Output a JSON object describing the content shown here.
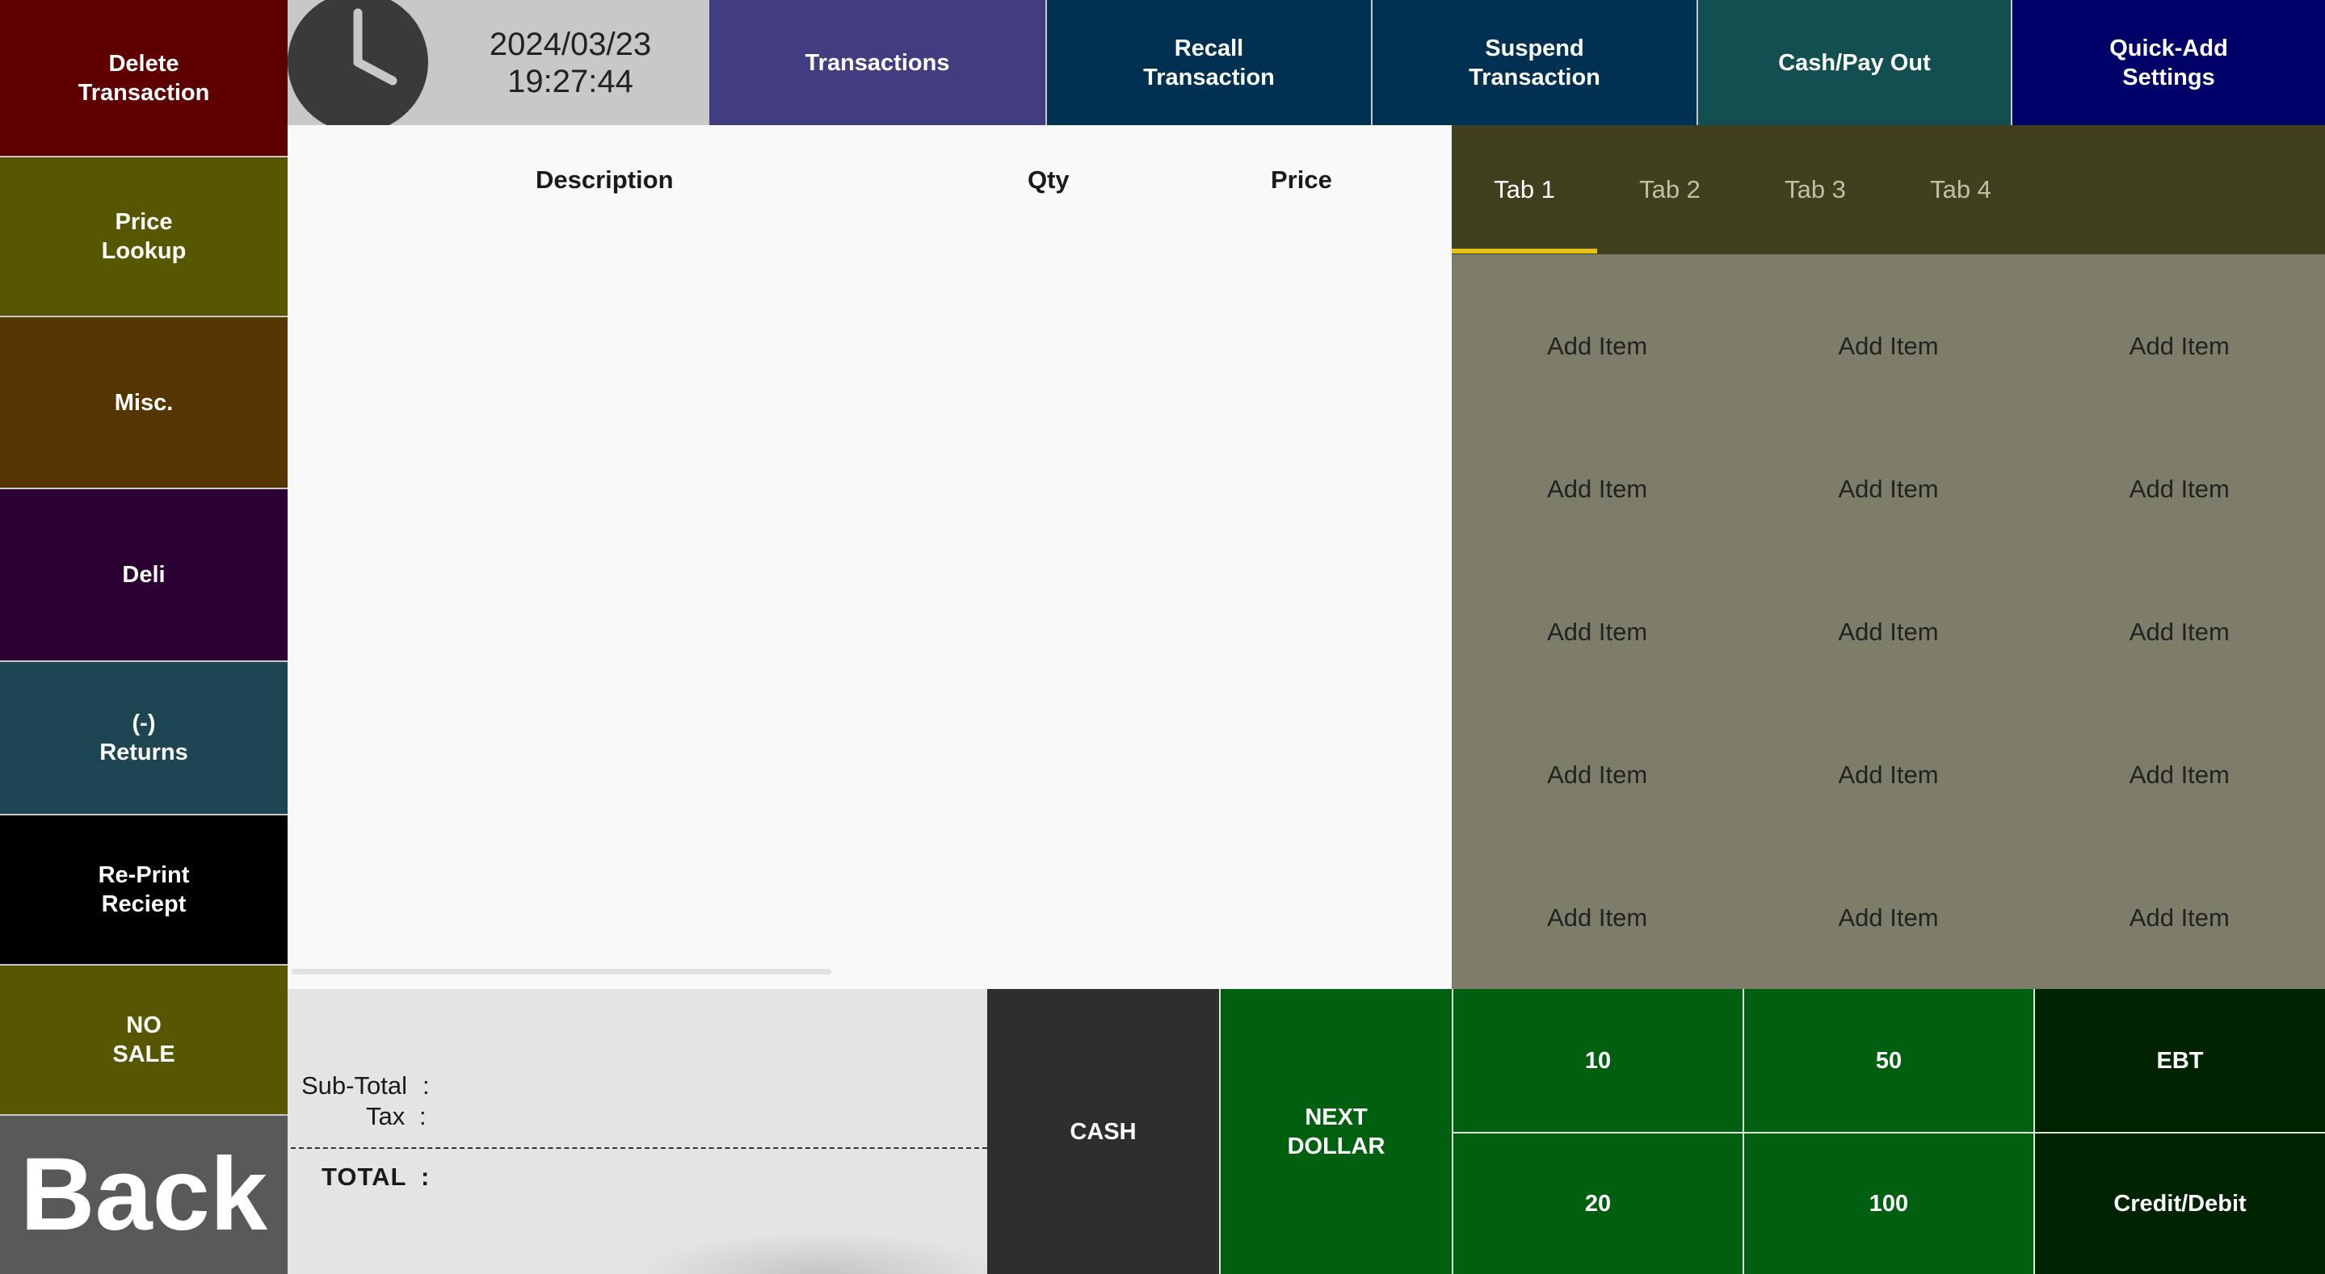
{
  "left_menu": {
    "delete_transaction": "Delete\nTransaction",
    "price_lookup": "Price\nLookup",
    "misc": "Misc.",
    "deli": "Deli",
    "returns": "(-)\nReturns",
    "reprint_receipt": "Re-Print\nReciept",
    "no_sale": "NO\nSALE",
    "back": "Back"
  },
  "clock": {
    "date": "2024/03/23",
    "time": "19:27:44",
    "icon": "clock-icon"
  },
  "top_menu": {
    "transactions": "Transactions",
    "recall_transaction": "Recall\nTransaction",
    "suspend_transaction": "Suspend\nTransaction",
    "cash_pay_out": "Cash/Pay Out",
    "quick_add_settings": "Quick-Add\nSettings"
  },
  "item_list": {
    "columns": [
      "Description",
      "Qty",
      "Price"
    ],
    "rows": []
  },
  "quick_add": {
    "tabs": [
      "Tab 1",
      "Tab 2",
      "Tab 3",
      "Tab 4"
    ],
    "active_tab": "Tab 1",
    "items": [
      "Add Item",
      "Add Item",
      "Add Item",
      "Add Item",
      "Add Item",
      "Add Item",
      "Add Item",
      "Add Item",
      "Add Item",
      "Add Item",
      "Add Item",
      "Add Item",
      "Add Item",
      "Add Item",
      "Add Item"
    ]
  },
  "totals": {
    "subtotal_label": "Sub-Total",
    "tax_label": "Tax",
    "total_label": "TOTAL",
    "separator": ":"
  },
  "payment": {
    "cash": "CASH",
    "next_dollar": "NEXT\nDOLLAR",
    "ten": "10",
    "fifty": "50",
    "twenty": "20",
    "hundred": "100",
    "ebt": "EBT",
    "credit_debit": "Credit/Debit"
  },
  "colors": {
    "delete": "#5e0000",
    "price_lookup": "#565700",
    "misc": "#553600",
    "deli": "#2b0032",
    "returns": "#1d4552",
    "reprint": "#000000",
    "no_sale": "#565700",
    "back": "#595959",
    "transactions": "#423d80",
    "recall": "#003052",
    "suspend": "#003052",
    "cash_pay_out": "#134f51",
    "quick_add_settings": "#000069",
    "cash": "#2e2e2e",
    "green": "#00600f",
    "dark_green": "#002402",
    "tab_indicator": "#e8c21a"
  }
}
